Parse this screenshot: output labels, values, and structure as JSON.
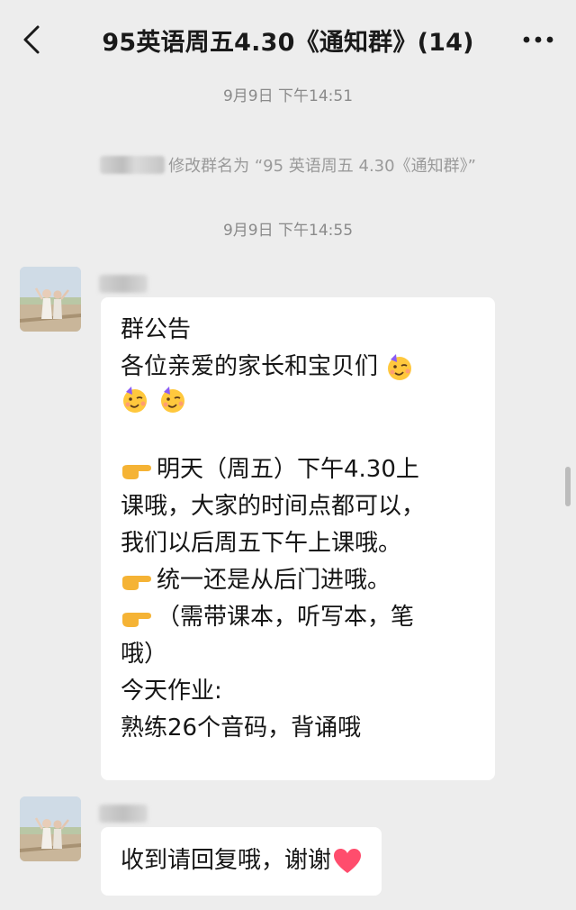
{
  "header": {
    "title": "95英语周五4.30《通知群》(14)",
    "back_icon": "chevron-left-icon",
    "more_icon": "more-dots-icon"
  },
  "timestamps": [
    "9月9日 下午14:51",
    "9月9日 下午14:55"
  ],
  "system_notice": {
    "text": "修改群名为 “95 英语周五 4.30《通知群》”"
  },
  "messages": [
    {
      "avatar": "avatar-photo",
      "lines": [
        "群公告",
        "各位亲爱的家长和宝贝们",
        "",
        "",
        "明天（周五）下午4.30上",
        "课哦，大家的时间点都可以，",
        "我们以后周五下午上课哦。",
        "统一还是从后门进哦。",
        "（需带课本，听写本，笔",
        "哦）",
        "今天作业:",
        "熟练26个音码，背诵哦"
      ]
    },
    {
      "avatar": "avatar-photo",
      "text": "收到请回复哦，谢谢"
    }
  ],
  "colors": {
    "background": "#ededed",
    "bubble": "#ffffff",
    "heart": "#ff4d6d"
  }
}
